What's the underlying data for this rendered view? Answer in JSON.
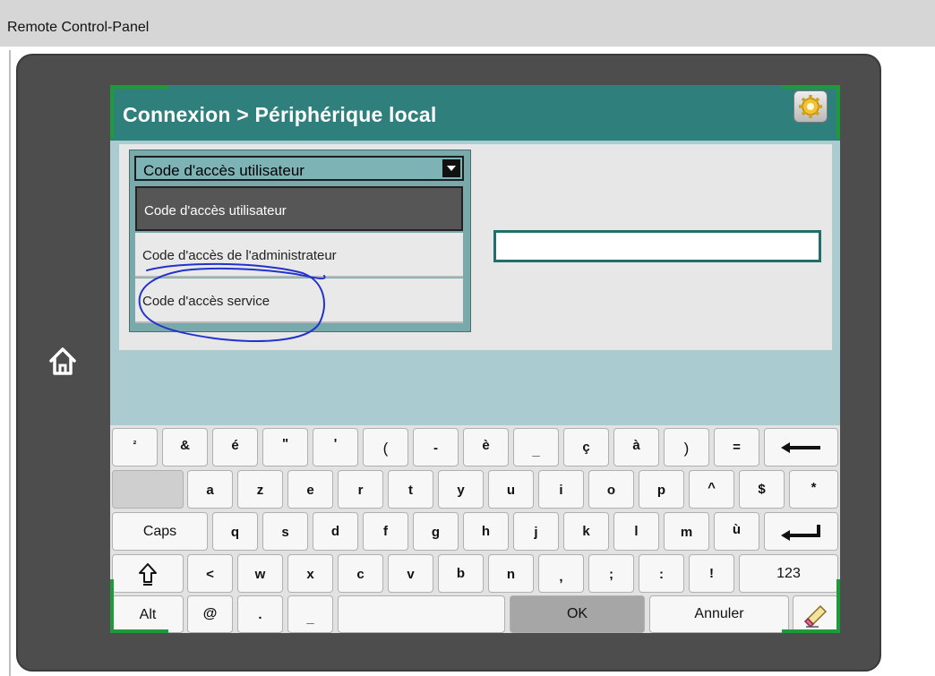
{
  "window": {
    "title": "Remote Control-Panel"
  },
  "header": {
    "title": "Connexion > Périphérique local",
    "settings_icon": "gear-icon"
  },
  "home": {
    "icon": "home-icon"
  },
  "dropdown": {
    "selected": "Code d'accès utilisateur",
    "options": [
      "Code d'accès utilisateur",
      "Code d'accès de l'administrateur",
      "Code d'accès service"
    ],
    "highlighted_index": 0
  },
  "password_field": {
    "value": ""
  },
  "keyboard": {
    "row1": [
      "²",
      "&",
      "é",
      "\"",
      "'",
      "(",
      "-",
      "è",
      "_",
      "ç",
      "à",
      ")",
      "=",
      ""
    ],
    "row2": [
      "",
      "a",
      "z",
      "e",
      "r",
      "t",
      "y",
      "u",
      "i",
      "o",
      "p",
      "^",
      "$",
      "*"
    ],
    "row3": [
      "Caps",
      "q",
      "s",
      "d",
      "f",
      "g",
      "h",
      "j",
      "k",
      "l",
      "m",
      "ù",
      ""
    ],
    "row4": [
      "",
      "<",
      "w",
      "x",
      "c",
      "v",
      "b",
      "n",
      ",",
      ";",
      ":",
      "!",
      "123"
    ],
    "row5": [
      "Alt",
      "@",
      ".",
      "_",
      "",
      "OK",
      "Annuler",
      ""
    ]
  },
  "colors": {
    "header": "#2f7f7d",
    "screen_bg": "#aacbcf",
    "annotation": "#2233cc",
    "device": "#4d4d4d"
  }
}
